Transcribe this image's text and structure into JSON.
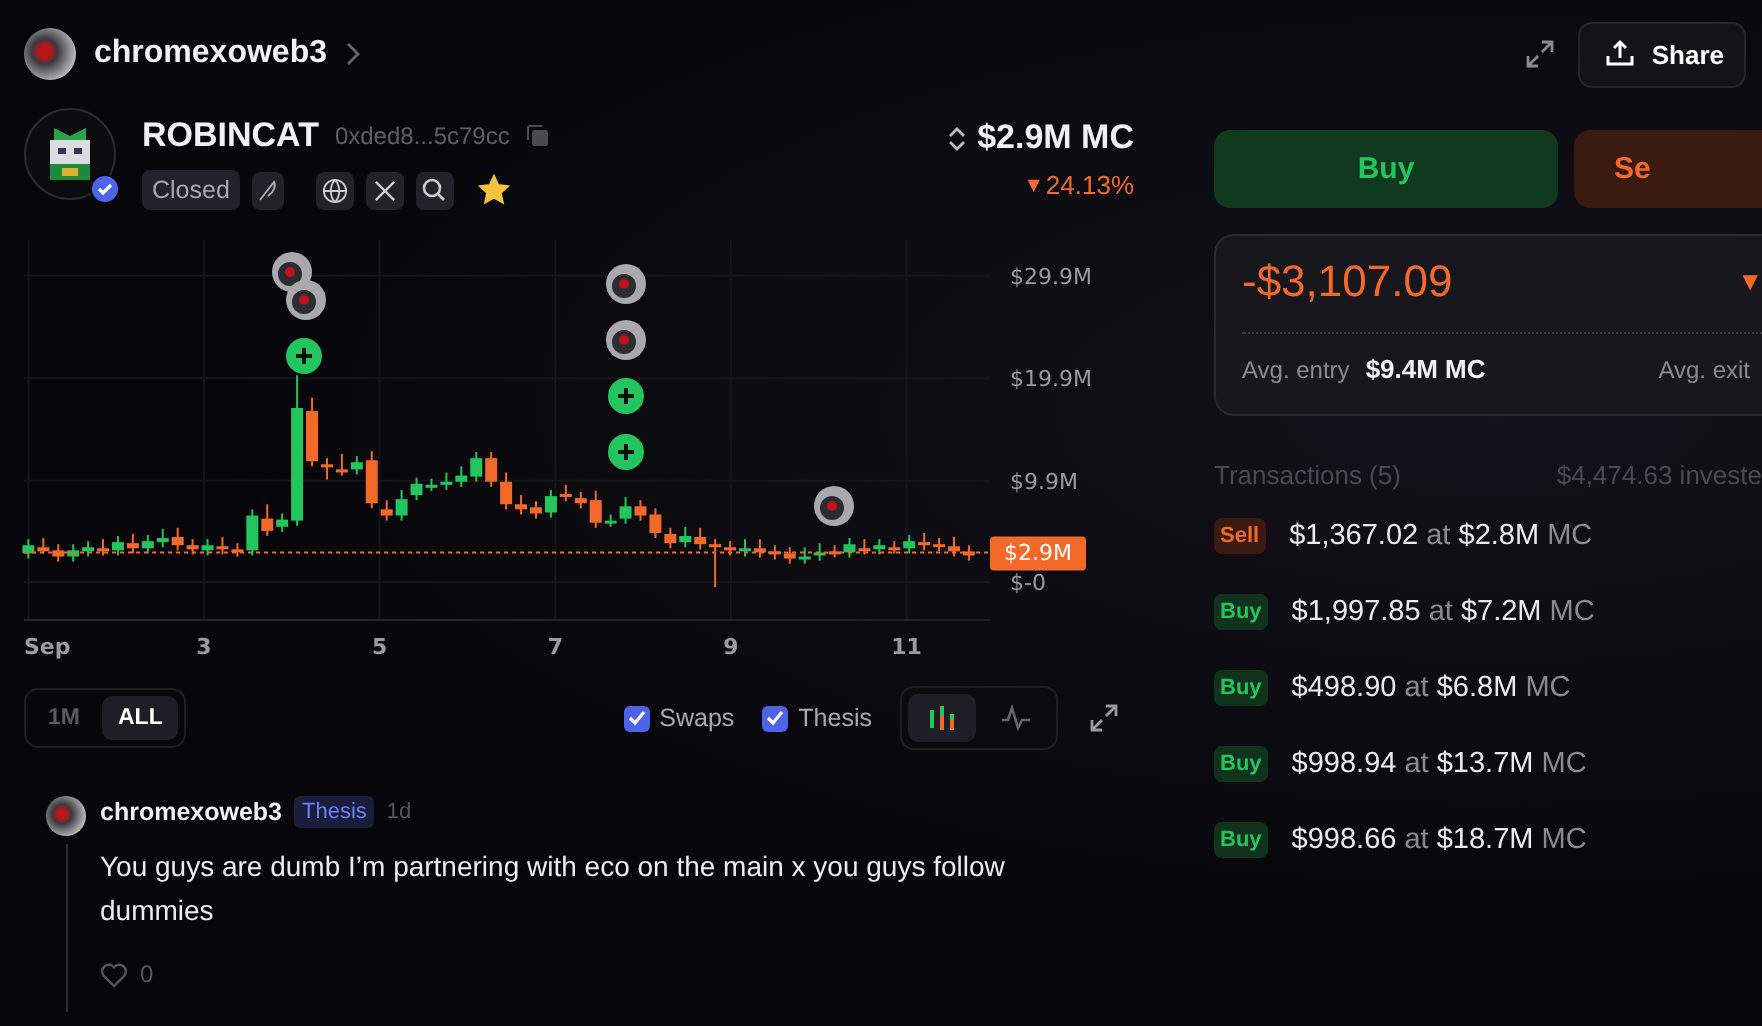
{
  "profile": {
    "username": "chromexoweb3"
  },
  "header_actions": {
    "share": "Share"
  },
  "token": {
    "name": "ROBINCAT",
    "address": "0xded8...5c79cc",
    "verified": true,
    "status": "Closed",
    "favorite": true,
    "market_cap": "$2.9M MC",
    "change_arrow": "▼",
    "change": "24.13%"
  },
  "chart": {
    "chart_data": {
      "type": "candlestick",
      "xlim": [
        0.95,
        11.95
      ],
      "ylim": [
        -3.7,
        33.4
      ],
      "xticks": [
        {
          "value": 1,
          "label": "Sep"
        },
        {
          "value": 3,
          "label": "3"
        },
        {
          "value": 5,
          "label": "5"
        },
        {
          "value": 7,
          "label": "7"
        },
        {
          "value": 9,
          "label": "9"
        },
        {
          "value": 11,
          "label": "11"
        }
      ],
      "yticks": [
        {
          "value": 29.9,
          "label": "$29.9M"
        },
        {
          "value": 19.9,
          "label": "$19.9M"
        },
        {
          "value": 9.9,
          "label": "$9.9M"
        },
        {
          "value": 0,
          "label": "$-0"
        }
      ],
      "x": [
        1,
        1.17,
        1.34,
        1.51,
        1.68,
        1.85,
        2.02,
        2.19,
        2.36,
        2.53,
        2.7,
        2.87,
        3.04,
        3.21,
        3.38,
        3.55,
        3.72,
        3.89,
        4.06,
        4.23,
        4.4,
        4.57,
        4.74,
        4.91,
        5.08,
        5.25,
        5.42,
        5.59,
        5.76,
        5.93,
        6.1,
        6.27,
        6.44,
        6.61,
        6.78,
        6.95,
        7.12,
        7.29,
        7.46,
        7.63,
        7.8,
        7.97,
        8.14,
        8.31,
        8.48,
        8.65,
        8.82,
        8.99,
        9.16,
        9.33,
        9.5,
        9.67,
        9.84,
        10.01,
        10.18,
        10.35,
        10.52,
        10.69,
        10.86,
        11.03,
        11.2,
        11.37,
        11.54,
        11.71
      ],
      "ohlc": [
        [
          2.8,
          4.2,
          2.3,
          3.6
        ],
        [
          3.4,
          4.3,
          2.8,
          3.0
        ],
        [
          3.1,
          3.7,
          2.0,
          2.5
        ],
        [
          2.5,
          3.7,
          2.0,
          3.1
        ],
        [
          3.0,
          4.0,
          2.5,
          3.4
        ],
        [
          3.3,
          4.2,
          2.6,
          3.1
        ],
        [
          3.1,
          4.5,
          2.6,
          3.9
        ],
        [
          3.8,
          4.7,
          2.8,
          3.3
        ],
        [
          3.3,
          4.6,
          2.8,
          4.0
        ],
        [
          3.9,
          5.2,
          3.4,
          4.3
        ],
        [
          4.4,
          5.3,
          3.1,
          3.6
        ],
        [
          3.6,
          4.2,
          2.7,
          3.2
        ],
        [
          3.1,
          4.2,
          2.6,
          3.6
        ],
        [
          3.5,
          4.4,
          2.7,
          3.2
        ],
        [
          3.2,
          3.8,
          2.5,
          3.0
        ],
        [
          3.1,
          7.1,
          2.6,
          6.5
        ],
        [
          6.2,
          7.6,
          4.5,
          5.0
        ],
        [
          5.4,
          6.7,
          4.9,
          6.1
        ],
        [
          6.0,
          20.2,
          5.5,
          17.0
        ],
        [
          16.7,
          18.0,
          11.3,
          11.8
        ],
        [
          11.5,
          12.1,
          10.0,
          11.2
        ],
        [
          11.0,
          12.5,
          10.4,
          10.9
        ],
        [
          11.0,
          12.3,
          10.5,
          11.7
        ],
        [
          11.9,
          12.8,
          7.2,
          7.7
        ],
        [
          7.1,
          8.0,
          6.0,
          6.5
        ],
        [
          6.5,
          9.0,
          6.0,
          8.1
        ],
        [
          8.5,
          10.2,
          8.0,
          9.6
        ],
        [
          9.4,
          10.1,
          8.9,
          9.5
        ],
        [
          9.5,
          10.7,
          9.0,
          9.8
        ],
        [
          9.8,
          11.3,
          9.3,
          10.4
        ],
        [
          10.3,
          12.7,
          9.8,
          12.1
        ],
        [
          12.1,
          12.7,
          9.3,
          9.8
        ],
        [
          9.8,
          10.7,
          7.1,
          7.6
        ],
        [
          7.6,
          8.5,
          6.6,
          7.1
        ],
        [
          7.3,
          7.9,
          6.2,
          6.7
        ],
        [
          6.8,
          9.0,
          6.3,
          8.4
        ],
        [
          8.6,
          9.5,
          7.9,
          8.4
        ],
        [
          8.2,
          8.8,
          7.2,
          7.7
        ],
        [
          8.0,
          8.9,
          5.3,
          5.8
        ],
        [
          5.9,
          6.6,
          5.4,
          6.0
        ],
        [
          6.2,
          8.3,
          5.7,
          7.4
        ],
        [
          7.4,
          8.0,
          6.0,
          6.5
        ],
        [
          6.6,
          7.2,
          4.3,
          4.8
        ],
        [
          4.7,
          5.3,
          3.3,
          3.8
        ],
        [
          3.9,
          5.4,
          3.4,
          4.5
        ],
        [
          4.4,
          5.3,
          3.2,
          3.7
        ],
        [
          3.7,
          4.2,
          -0.5,
          3.4
        ],
        [
          3.4,
          4.0,
          2.6,
          3.1
        ],
        [
          3.0,
          4.2,
          2.5,
          3.3
        ],
        [
          3.3,
          4.2,
          2.4,
          2.9
        ],
        [
          3.0,
          3.6,
          2.2,
          2.7
        ],
        [
          2.8,
          3.4,
          1.8,
          2.3
        ],
        [
          2.3,
          3.4,
          1.8,
          2.5
        ],
        [
          2.6,
          3.8,
          2.1,
          2.9
        ],
        [
          3.0,
          3.6,
          2.4,
          2.9
        ],
        [
          2.9,
          4.3,
          2.4,
          3.7
        ],
        [
          3.3,
          4.2,
          2.7,
          3.2
        ],
        [
          3.2,
          4.2,
          2.7,
          3.6
        ],
        [
          3.4,
          4.0,
          2.8,
          3.3
        ],
        [
          3.3,
          4.6,
          2.8,
          4.0
        ],
        [
          3.9,
          4.8,
          3.1,
          3.6
        ],
        [
          3.7,
          4.3,
          3.0,
          3.5
        ],
        [
          3.5,
          4.4,
          2.5,
          3.0
        ],
        [
          3.0,
          3.6,
          2.1,
          2.6
        ]
      ],
      "grid": true,
      "ref_lines": [
        {
          "axis": "y",
          "value": 2.9,
          "label": "$2.9M",
          "color": "#f2692a"
        }
      ]
    },
    "markers": [
      {
        "kind": "avatar"
      },
      {
        "kind": "avatar"
      },
      {
        "kind": "buy"
      },
      {
        "kind": "avatar"
      },
      {
        "kind": "avatar"
      },
      {
        "kind": "buy"
      },
      {
        "kind": "buy"
      },
      {
        "kind": "avatar"
      }
    ]
  },
  "chart_controls": {
    "ranges": [
      {
        "label": "1M",
        "selected": false
      },
      {
        "label": "ALL",
        "selected": true
      }
    ],
    "toggles": [
      {
        "label": "Swaps",
        "checked": true
      },
      {
        "label": "Thesis",
        "checked": true
      }
    ],
    "chart_types": [
      {
        "kind": "candles",
        "selected": true
      },
      {
        "kind": "line",
        "selected": false
      }
    ]
  },
  "comments": [
    {
      "author": "chromexoweb3",
      "tag": "Thesis",
      "time": "1d",
      "text": "You guys are dumb I’m partnering with eco on the main x you guys follow dummies",
      "likes": "0",
      "liked": false
    }
  ],
  "trade": {
    "buttons": [
      {
        "label": "Buy",
        "kind": "buy"
      },
      {
        "label": "Se",
        "kind": "sell"
      }
    ]
  },
  "position": {
    "pnl": "-$3,107.09",
    "pnl_arrow": "▼",
    "entry_label": "Avg. entry",
    "entry_value": "$9.4M MC",
    "exit_label": "Avg. exit"
  },
  "transactions": {
    "title": "Transactions (5)",
    "invested": "$4,474.63 investe",
    "items": [
      {
        "kind": "sell",
        "label": "Sell",
        "text": "**$1,367.02** at **$2.8M** MC"
      },
      {
        "kind": "buy",
        "label": "Buy",
        "text": "**$1,997.85** at **$7.2M** MC"
      },
      {
        "kind": "buy",
        "label": "Buy",
        "text": "**$498.90** at **$6.8M** MC"
      },
      {
        "kind": "buy",
        "label": "Buy",
        "text": "**$998.94** at **$13.7M** MC"
      },
      {
        "kind": "buy",
        "label": "Buy",
        "text": "**$998.66** at **$18.7M** MC"
      }
    ]
  }
}
